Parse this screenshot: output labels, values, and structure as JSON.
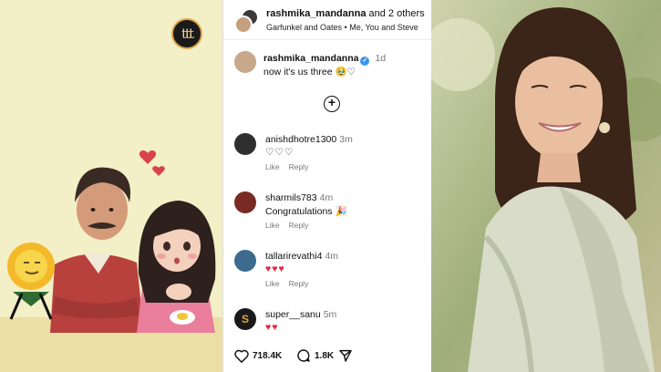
{
  "left_panel": {
    "badge_text": "ttt"
  },
  "post": {
    "header": {
      "title_user": "rashmika_mandanna",
      "title_suffix": "and 2 others",
      "audio": "Garfunkel and Oates • Me, You and Steve"
    },
    "caption": {
      "user": "rashmika_mandanna",
      "time": "1d",
      "text": "now it's us three 🥹♡"
    },
    "comments": [
      {
        "user": "anishdhotre1300",
        "time": "3m",
        "text": "♡♡♡",
        "like": "Like",
        "reply": "Reply"
      },
      {
        "user": "sharmils783",
        "time": "4m",
        "text": "Congratulations 🎉",
        "like": "Like",
        "reply": "Reply"
      },
      {
        "user": "tallarirevathi4",
        "time": "4m",
        "text": "♥♥♥",
        "like": "Like",
        "reply": "Reply"
      },
      {
        "user": "super__sanu",
        "time": "5m",
        "text": "♥♥"
      }
    ],
    "actions": {
      "likes": "718.4K",
      "comments": "1.8K"
    }
  },
  "colors": {
    "left_bg": "#f3efc6",
    "heart_red": "#e0243b",
    "verified_blue": "#3897f0"
  },
  "icons": [
    "ttt-badge-icon",
    "add-circle-icon",
    "heart-icon",
    "comment-icon",
    "share-icon",
    "verified-icon"
  ]
}
